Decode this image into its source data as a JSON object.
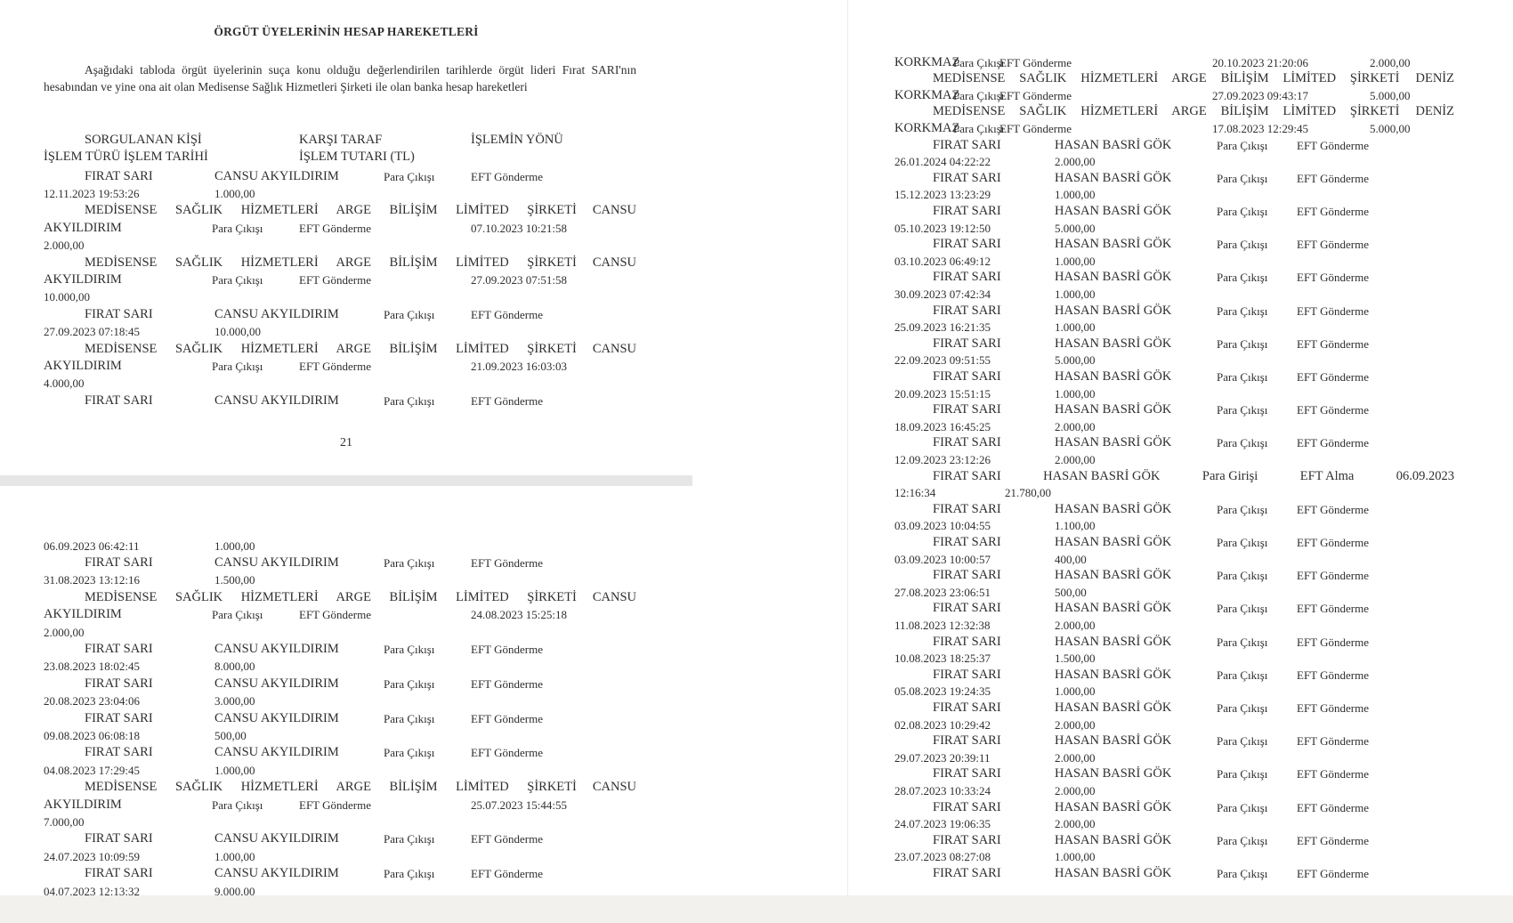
{
  "left_page": {
    "title": "ÖRGÜT ÜYELERİNİN HESAP HAREKETLERİ",
    "intro": "Aşağıdaki tabloda örgüt üyelerinin suça konu olduğu değerlendirilen tarihlerde örgüt lideri Fırat SARI'nın hesabından ve yine ona ait olan Medisense Sağlık Hizmetleri Şirketi ile olan banka hesap hareketleri",
    "headers": {
      "subject": "SORGULANAN KİŞİ",
      "counterparty": "KARŞI TARAF",
      "direction": "İŞLEMİN YÖNÜ",
      "type_date": "İŞLEM TÜRÜ İŞLEM TARİHİ",
      "amount": "İŞLEM TUTARI (TL)"
    },
    "records": [
      {
        "kind": "simple",
        "subject": "FIRAT SARI",
        "counterparty": "CANSU AKYILDIRIM",
        "direction": "Para Çıkışı",
        "type": "EFT Gönderme",
        "datetime": "12.11.2023 19:53:26",
        "amount": "1.000,00"
      },
      {
        "kind": "company",
        "subject": "MEDİSENSE SAĞLIK HİZMETLERİ ARGE BİLİŞİM LİMİTED ŞİRKETİ",
        "counterparty": [
          "CANSU",
          "AKYILDIRIM"
        ],
        "direction": "Para Çıkışı",
        "type": "EFT Gönderme",
        "datetime": "07.10.2023 10:21:58",
        "amount": "2.000,00"
      },
      {
        "kind": "company",
        "subject": "MEDİSENSE SAĞLIK HİZMETLERİ ARGE BİLİŞİM LİMİTED ŞİRKETİ",
        "counterparty": [
          "CANSU",
          "AKYILDIRIM"
        ],
        "direction": "Para Çıkışı",
        "type": "EFT Gönderme",
        "datetime": "27.09.2023 07:51:58",
        "amount": "10.000,00"
      },
      {
        "kind": "simple",
        "subject": "FIRAT SARI",
        "counterparty": "CANSU AKYILDIRIM",
        "direction": "Para Çıkışı",
        "type": "EFT Gönderme",
        "datetime": "27.09.2023 07:18:45",
        "amount": "10.000,00"
      },
      {
        "kind": "company",
        "subject": "MEDİSENSE SAĞLIK HİZMETLERİ ARGE BİLİŞİM LİMİTED ŞİRKETİ",
        "counterparty": [
          "CANSU",
          "AKYILDIRIM"
        ],
        "direction": "Para Çıkışı",
        "type": "EFT Gönderme",
        "datetime": "21.09.2023 16:03:03",
        "amount": "4.000,00"
      },
      {
        "kind": "simple",
        "subject": "FIRAT SARI",
        "counterparty": "CANSU AKYILDIRIM",
        "direction": "Para Çıkışı",
        "type": "EFT Gönderme"
      }
    ],
    "page_number": "21"
  },
  "left_page_continued": {
    "records": [
      {
        "kind": "tail",
        "datetime": "06.09.2023 06:42:11",
        "amount": "1.000,00"
      },
      {
        "kind": "simple",
        "subject": "FIRAT SARI",
        "counterparty": "CANSU AKYILDIRIM",
        "direction": "Para Çıkışı",
        "type": "EFT Gönderme",
        "datetime": "31.08.2023 13:12:16",
        "amount": "1.500,00"
      },
      {
        "kind": "company",
        "subject": "MEDİSENSE SAĞLIK HİZMETLERİ ARGE BİLİŞİM LİMİTED ŞİRKETİ",
        "counterparty": [
          "CANSU",
          "AKYILDIRIM"
        ],
        "direction": "Para Çıkışı",
        "type": "EFT Gönderme",
        "datetime": "24.08.2023 15:25:18",
        "amount": "2.000,00"
      },
      {
        "kind": "simple",
        "subject": "FIRAT SARI",
        "counterparty": "CANSU AKYILDIRIM",
        "direction": "Para Çıkışı",
        "type": "EFT Gönderme",
        "datetime": "23.08.2023 18:02:45",
        "amount": "8.000,00"
      },
      {
        "kind": "simple",
        "subject": "FIRAT SARI",
        "counterparty": "CANSU AKYILDIRIM",
        "direction": "Para Çıkışı",
        "type": "EFT Gönderme",
        "datetime": "20.08.2023 23:04:06",
        "amount": "3.000,00"
      },
      {
        "kind": "simple",
        "subject": "FIRAT SARI",
        "counterparty": "CANSU AKYILDIRIM",
        "direction": "Para Çıkışı",
        "type": "EFT Gönderme",
        "datetime": "09.08.2023 06:08:18",
        "amount": "500,00"
      },
      {
        "kind": "simple",
        "subject": "FIRAT SARI",
        "counterparty": "CANSU AKYILDIRIM",
        "direction": "Para Çıkışı",
        "type": "EFT Gönderme",
        "datetime": "04.08.2023 17:29:45",
        "amount": "1.000,00"
      },
      {
        "kind": "company",
        "subject": "MEDİSENSE SAĞLIK HİZMETLERİ ARGE BİLİŞİM LİMİTED ŞİRKETİ",
        "counterparty": [
          "CANSU",
          "AKYILDIRIM"
        ],
        "direction": "Para Çıkışı",
        "type": "EFT Gönderme",
        "datetime": "25.07.2023 15:44:55",
        "amount": "7.000,00"
      },
      {
        "kind": "simple",
        "subject": "FIRAT SARI",
        "counterparty": "CANSU AKYILDIRIM",
        "direction": "Para Çıkışı",
        "type": "EFT Gönderme",
        "datetime": "24.07.2023 10:09:59",
        "amount": "1.000,00"
      },
      {
        "kind": "simple",
        "subject": "FIRAT SARI",
        "counterparty": "CANSU AKYILDIRIM",
        "direction": "Para Çıkışı",
        "type": "EFT Gönderme",
        "datetime": "04.07.2023 12:13:32",
        "amount": "9.000,00"
      }
    ]
  },
  "right_page": {
    "records": [
      {
        "kind": "tail_row",
        "counterparty_end": "KORKMAZ",
        "direction": "Para Çıkışı",
        "type": "EFT Gönderme",
        "datetime": "20.10.2023 21:20:06",
        "amount": "2.000,00"
      },
      {
        "kind": "company",
        "subject": "MEDİSENSE SAĞLIK HİZMETLERİ ARGE BİLİŞİM LİMİTED ŞİRKETİ",
        "counterparty": [
          "DENİZ",
          "KORKMAZ"
        ],
        "direction": "Para Çıkışı",
        "type": "EFT Gönderme",
        "datetime": "27.09.2023 09:43:17",
        "amount": "5.000,00"
      },
      {
        "kind": "company",
        "subject": "MEDİSENSE SAĞLIK HİZMETLERİ ARGE BİLİŞİM LİMİTED ŞİRKETİ",
        "counterparty": [
          "DENİZ",
          "KORKMAZ"
        ],
        "direction": "Para Çıkışı",
        "type": "EFT Gönderme",
        "datetime": "17.08.2023 12:29:45",
        "amount": "5.000,00"
      },
      {
        "kind": "simple",
        "subject": "FIRAT SARI",
        "counterparty": "HASAN BASRİ GÖK",
        "direction": "Para Çıkışı",
        "type": "EFT Gönderme",
        "datetime": "26.01.2024 04:22:22",
        "amount": "2.000,00"
      },
      {
        "kind": "simple",
        "subject": "FIRAT SARI",
        "counterparty": "HASAN BASRİ GÖK",
        "direction": "Para Çıkışı",
        "type": "EFT Gönderme",
        "datetime": "15.12.2023 13:23:29",
        "amount": "1.000,00"
      },
      {
        "kind": "simple",
        "subject": "FIRAT SARI",
        "counterparty": "HASAN BASRİ GÖK",
        "direction": "Para Çıkışı",
        "type": "EFT Gönderme",
        "datetime": "05.10.2023 19:12:50",
        "amount": "5.000,00"
      },
      {
        "kind": "simple",
        "subject": "FIRAT SARI",
        "counterparty": "HASAN BASRİ GÖK",
        "direction": "Para Çıkışı",
        "type": "EFT Gönderme",
        "datetime": "03.10.2023 06:49:12",
        "amount": "1.000,00"
      },
      {
        "kind": "simple",
        "subject": "FIRAT SARI",
        "counterparty": "HASAN BASRİ GÖK",
        "direction": "Para Çıkışı",
        "type": "EFT Gönderme",
        "datetime": "30.09.2023 07:42:34",
        "amount": "1.000,00"
      },
      {
        "kind": "simple",
        "subject": "FIRAT SARI",
        "counterparty": "HASAN BASRİ GÖK",
        "direction": "Para Çıkışı",
        "type": "EFT Gönderme",
        "datetime": "25.09.2023 16:21:35",
        "amount": "1.000,00"
      },
      {
        "kind": "simple",
        "subject": "FIRAT SARI",
        "counterparty": "HASAN BASRİ GÖK",
        "direction": "Para Çıkışı",
        "type": "EFT Gönderme",
        "datetime": "22.09.2023 09:51:55",
        "amount": "5.000,00"
      },
      {
        "kind": "simple",
        "subject": "FIRAT SARI",
        "counterparty": "HASAN BASRİ GÖK",
        "direction": "Para Çıkışı",
        "type": "EFT Gönderme",
        "datetime": "20.09.2023 15:51:15",
        "amount": "1.000,00"
      },
      {
        "kind": "simple",
        "subject": "FIRAT SARI",
        "counterparty": "HASAN BASRİ GÖK",
        "direction": "Para Çıkışı",
        "type": "EFT Gönderme",
        "datetime": "18.09.2023 16:45:25",
        "amount": "2.000,00"
      },
      {
        "kind": "simple",
        "subject": "FIRAT SARI",
        "counterparty": "HASAN BASRİ GÖK",
        "direction": "Para Çıkışı",
        "type": "EFT Gönderme",
        "datetime": "12.09.2023 23:12:26",
        "amount": "2.000,00"
      },
      {
        "kind": "wrapped",
        "subject": "FIRAT SARI",
        "counterparty": "HASAN BASRİ GÖK",
        "direction": "Para Girişi",
        "type": "EFT Alma",
        "datetime": [
          "06.09.2023",
          "12:16:34"
        ],
        "amount": "21.780,00"
      },
      {
        "kind": "simple",
        "subject": "FIRAT SARI",
        "counterparty": "HASAN BASRİ GÖK",
        "direction": "Para Çıkışı",
        "type": "EFT Gönderme",
        "datetime": "03.09.2023 10:04:55",
        "amount": "1.100,00"
      },
      {
        "kind": "simple",
        "subject": "FIRAT SARI",
        "counterparty": "HASAN BASRİ GÖK",
        "direction": "Para Çıkışı",
        "type": "EFT Gönderme",
        "datetime": "03.09.2023 10:00:57",
        "amount": "400,00"
      },
      {
        "kind": "simple",
        "subject": "FIRAT SARI",
        "counterparty": "HASAN BASRİ GÖK",
        "direction": "Para Çıkışı",
        "type": "EFT Gönderme",
        "datetime": "27.08.2023 23:06:51",
        "amount": "500,00"
      },
      {
        "kind": "simple",
        "subject": "FIRAT SARI",
        "counterparty": "HASAN BASRİ GÖK",
        "direction": "Para Çıkışı",
        "type": "EFT Gönderme",
        "datetime": "11.08.2023 12:32:38",
        "amount": "2.000,00"
      },
      {
        "kind": "simple",
        "subject": "FIRAT SARI",
        "counterparty": "HASAN BASRİ GÖK",
        "direction": "Para Çıkışı",
        "type": "EFT Gönderme",
        "datetime": "10.08.2023 18:25:37",
        "amount": "1.500,00"
      },
      {
        "kind": "simple",
        "subject": "FIRAT SARI",
        "counterparty": "HASAN BASRİ GÖK",
        "direction": "Para Çıkışı",
        "type": "EFT Gönderme",
        "datetime": "05.08.2023 19:24:35",
        "amount": "1.000,00"
      },
      {
        "kind": "simple",
        "subject": "FIRAT SARI",
        "counterparty": "HASAN BASRİ GÖK",
        "direction": "Para Çıkışı",
        "type": "EFT Gönderme",
        "datetime": "02.08.2023 10:29:42",
        "amount": "2.000,00"
      },
      {
        "kind": "simple",
        "subject": "FIRAT SARI",
        "counterparty": "HASAN BASRİ GÖK",
        "direction": "Para Çıkışı",
        "type": "EFT Gönderme",
        "datetime": "29.07.2023 20:39:11",
        "amount": "2.000,00"
      },
      {
        "kind": "simple",
        "subject": "FIRAT SARI",
        "counterparty": "HASAN BASRİ GÖK",
        "direction": "Para Çıkışı",
        "type": "EFT Gönderme",
        "datetime": "28.07.2023 10:33:24",
        "amount": "2.000,00"
      },
      {
        "kind": "simple",
        "subject": "FIRAT SARI",
        "counterparty": "HASAN BASRİ GÖK",
        "direction": "Para Çıkışı",
        "type": "EFT Gönderme",
        "datetime": "24.07.2023 19:06:35",
        "amount": "2.000,00"
      },
      {
        "kind": "simple",
        "subject": "FIRAT SARI",
        "counterparty": "HASAN BASRİ GÖK",
        "direction": "Para Çıkışı",
        "type": "EFT Gönderme",
        "datetime": "23.07.2023 08:27:08",
        "amount": "1.000,00"
      },
      {
        "kind": "simple",
        "subject": "FIRAT SARI",
        "counterparty": "HASAN BASRİ GÖK",
        "direction": "Para Çıkışı",
        "type": "EFT Gönderme"
      }
    ]
  }
}
